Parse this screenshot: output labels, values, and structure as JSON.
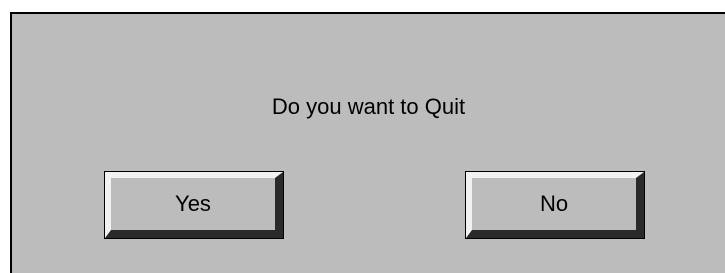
{
  "dialog": {
    "message": "Do you want to Quit",
    "buttons": {
      "yes_label": "Yes",
      "no_label": "No"
    }
  },
  "colors": {
    "dialog_background": "#bcbcbc",
    "bevel_light": "#f2f2f2",
    "bevel_dark": "#2a2a2a",
    "text": "#000000"
  }
}
